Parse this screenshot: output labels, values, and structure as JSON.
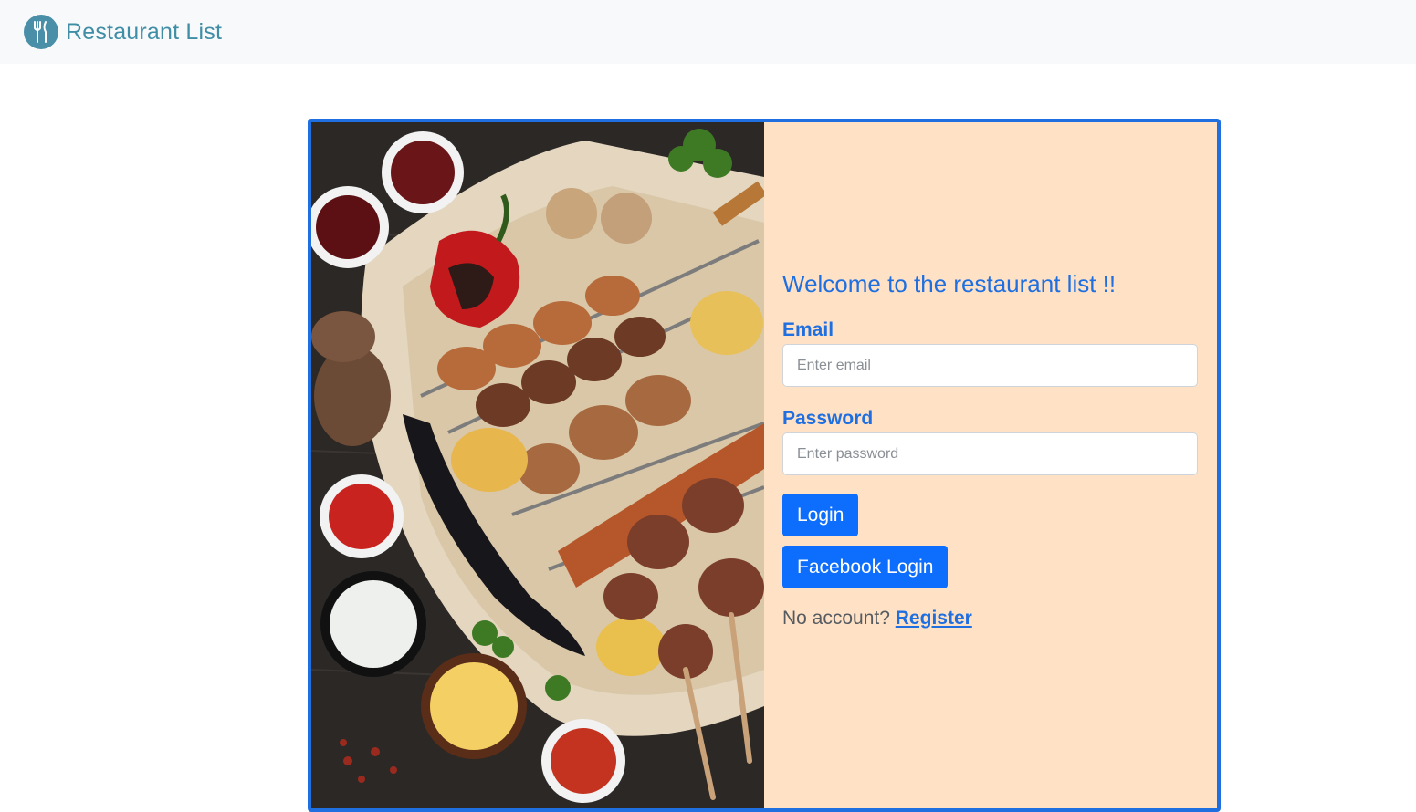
{
  "navbar": {
    "brand_text": "Restaurant List",
    "brand_icon": "fork-knife-icon",
    "brand_color": "#3f8ea6"
  },
  "login": {
    "welcome": "Welcome to the restaurant list !!",
    "email_label": "Email",
    "email_placeholder": "Enter email",
    "password_label": "Password",
    "password_placeholder": "Enter password",
    "login_button": "Login",
    "facebook_button": "Facebook Login",
    "no_account_text": "No account?",
    "register_link": "Register"
  },
  "colors": {
    "accent": "#1f6fe0",
    "button": "#0d6efd",
    "panel_bg": "#ffe2c6",
    "navbar_bg": "#f8f9fa"
  }
}
